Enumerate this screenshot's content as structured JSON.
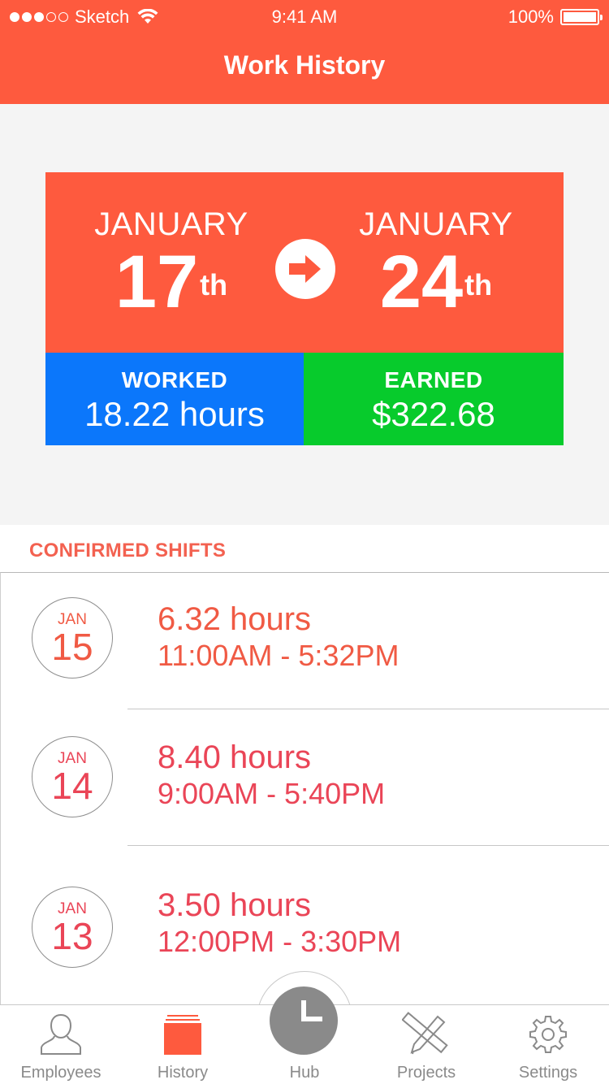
{
  "status_bar": {
    "carrier": "Sketch",
    "time": "9:41 AM",
    "battery": "100%"
  },
  "nav": {
    "title": "Work History"
  },
  "period": {
    "start": {
      "month": "JANUARY",
      "day": "17",
      "suffix": "th"
    },
    "end": {
      "month": "JANUARY",
      "day": "24",
      "suffix": "th"
    }
  },
  "stats": {
    "worked": {
      "label": "WORKED",
      "value": "18.22 hours"
    },
    "earned": {
      "label": "EARNED",
      "value": "$322.68"
    }
  },
  "section": {
    "title": "CONFIRMED SHIFTS"
  },
  "shifts": [
    {
      "month": "JAN",
      "day": "15",
      "hours_value": "6.32",
      "hours_unit": "hours",
      "range": "11:00AM - 5:32PM",
      "color": "#f05a44"
    },
    {
      "month": "JAN",
      "day": "14",
      "hours_value": "8.40",
      "hours_unit": "hours",
      "range": "9:00AM - 5:40PM",
      "color": "#ea4557"
    },
    {
      "month": "JAN",
      "day": "13",
      "hours_value": "3.50",
      "hours_unit": "hours",
      "range": "12:00PM - 3:30PM",
      "color": "#ea4557"
    }
  ],
  "tabs": [
    {
      "label": "Employees",
      "icon": "person-icon"
    },
    {
      "label": "History",
      "icon": "history-stack-icon",
      "active": true
    },
    {
      "label": "Hub",
      "icon": "clock-icon"
    },
    {
      "label": "Projects",
      "icon": "pencil-ruler-icon"
    },
    {
      "label": "Settings",
      "icon": "gear-icon"
    }
  ],
  "colors": {
    "brand": "#fe5a3e",
    "worked": "#0b77fb",
    "earned": "#07cb2c",
    "tab_inactive": "#8a8a8a"
  }
}
